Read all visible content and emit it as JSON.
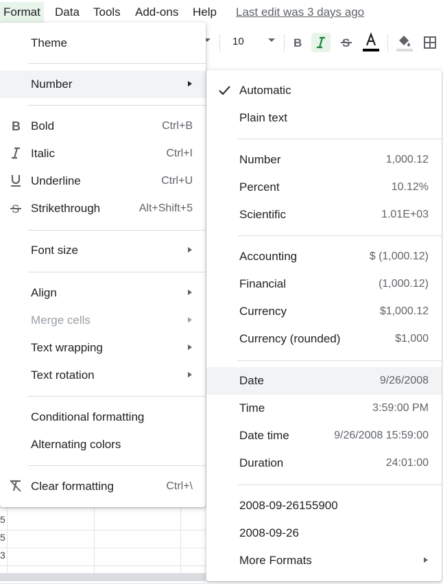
{
  "menubar": {
    "items": [
      "Format",
      "Data",
      "Tools",
      "Add-ons",
      "Help"
    ],
    "last_edit": "Last edit was 3 days ago"
  },
  "toolbar": {
    "font_size": "10"
  },
  "sheet": {
    "row_numbers": [
      "5",
      "5",
      "3"
    ]
  },
  "format_menu": {
    "theme": "Theme",
    "number": "Number",
    "bold": {
      "label": "Bold",
      "shortcut": "Ctrl+B"
    },
    "italic": {
      "label": "Italic",
      "shortcut": "Ctrl+I"
    },
    "underline": {
      "label": "Underline",
      "shortcut": "Ctrl+U"
    },
    "strikethrough": {
      "label": "Strikethrough",
      "shortcut": "Alt+Shift+5"
    },
    "font_size": "Font size",
    "align": "Align",
    "merge_cells": "Merge cells",
    "text_wrapping": "Text wrapping",
    "text_rotation": "Text rotation",
    "conditional_formatting": "Conditional formatting",
    "alternating_colors": "Alternating colors",
    "clear_formatting": {
      "label": "Clear formatting",
      "shortcut": "Ctrl+\\"
    }
  },
  "number_menu": {
    "automatic": "Automatic",
    "plain_text": "Plain text",
    "number": {
      "label": "Number",
      "value": "1,000.12"
    },
    "percent": {
      "label": "Percent",
      "value": "10.12%"
    },
    "scientific": {
      "label": "Scientific",
      "value": "1.01E+03"
    },
    "accounting": {
      "label": "Accounting",
      "value": "$ (1,000.12)"
    },
    "financial": {
      "label": "Financial",
      "value": "(1,000.12)"
    },
    "currency": {
      "label": "Currency",
      "value": "$1,000.12"
    },
    "currency_rounded": {
      "label": "Currency (rounded)",
      "value": "$1,000"
    },
    "date": {
      "label": "Date",
      "value": "9/26/2008"
    },
    "time": {
      "label": "Time",
      "value": "3:59:00 PM"
    },
    "date_time": {
      "label": "Date time",
      "value": "9/26/2008 15:59:00"
    },
    "duration": {
      "label": "Duration",
      "value": "24:01:00"
    },
    "custom1": "2008-09-26155900",
    "custom2": "2008-09-26",
    "more_formats": "More Formats"
  },
  "colors": {
    "active_bg": "#e6f4ea",
    "hover_bg": "#f1f3f4",
    "text": "#202124",
    "secondary": "#5f6368"
  }
}
